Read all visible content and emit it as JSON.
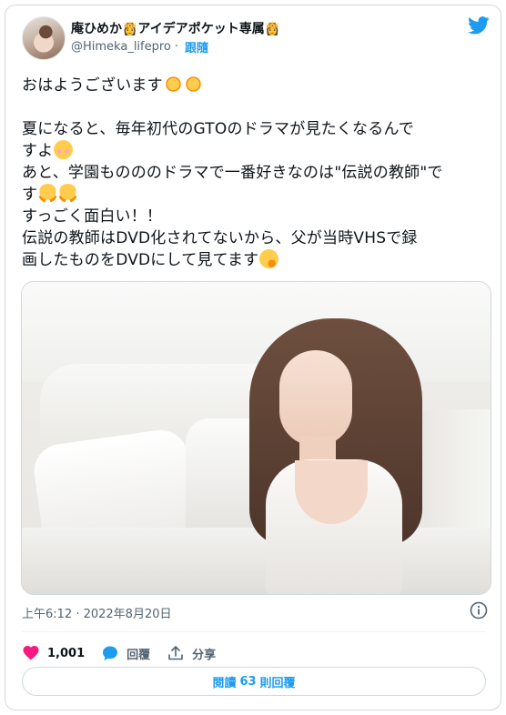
{
  "header": {
    "display_name": "庵ひめか👸アイデアポケット専属👸",
    "handle": "@Himeka_lifepro",
    "separator": "·",
    "follow_label": "跟隨",
    "logo_icon": "twitter-bird-icon",
    "brand_color": "#1d9bf0"
  },
  "tweet": {
    "line1": "おはようございます",
    "line2": "夏になると、毎年初代のGTOのドラマが見たくなるんで",
    "line3": "すよ",
    "line4": "あと、学園ものののドラマで一番好きなのは\"伝説の教師\"で",
    "line5": "す",
    "line6": "すっごく面白い！！",
    "line7": "伝説の教師はDVD化されてないから、父が当時VHSで録",
    "line8": "画したものをDVDにして見てます"
  },
  "timestamp": "上午6:12 · 2022年8月20日",
  "actions": {
    "like_count": "1,001",
    "reply_label": "回覆",
    "share_label": "分享"
  },
  "replies_button": {
    "prefix": "閱讀",
    "count": "63",
    "suffix": "則回覆"
  }
}
